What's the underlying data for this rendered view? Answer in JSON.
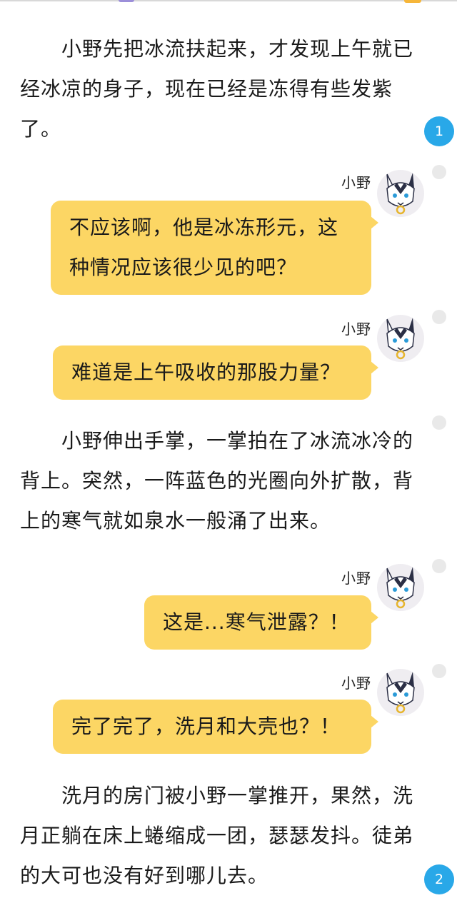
{
  "paragraphs": [
    "小野先把冰流扶起来，才发现上午就已经冰凉的身子，现在已经是冻得有些发紫了。",
    "小野伸出手掌，一掌拍在了冰流冰冷的背上。突然，一阵蓝色的光圈向外扩散，背上的寒气就如泉水一般涌了出来。",
    "洗月的房门被小野一掌推开，果然，洗月正躺在床上蜷缩成一团，瑟瑟发抖。徒弟的大可也没有好到哪儿去。"
  ],
  "messages": [
    {
      "name": "小野",
      "text": "不应该啊，他是冰冻形元，这种情况应该很少见的吧？",
      "avatar_icon": "wolf-avatar-icon"
    },
    {
      "name": "小野",
      "text": "难道是上午吸收的那股力量？",
      "avatar_icon": "wolf-avatar-icon"
    },
    {
      "name": "小野",
      "text": "这是...寒气泄露？！",
      "avatar_icon": "wolf-avatar-icon"
    },
    {
      "name": "小野",
      "text": "完了完了，洗月和大壳也？！",
      "avatar_icon": "wolf-avatar-icon"
    }
  ],
  "comment_badges": [
    "1",
    "2"
  ],
  "colors": {
    "bubble": "#fcd664",
    "badge": "#29a8e8",
    "dot": "#e9e9e9"
  }
}
